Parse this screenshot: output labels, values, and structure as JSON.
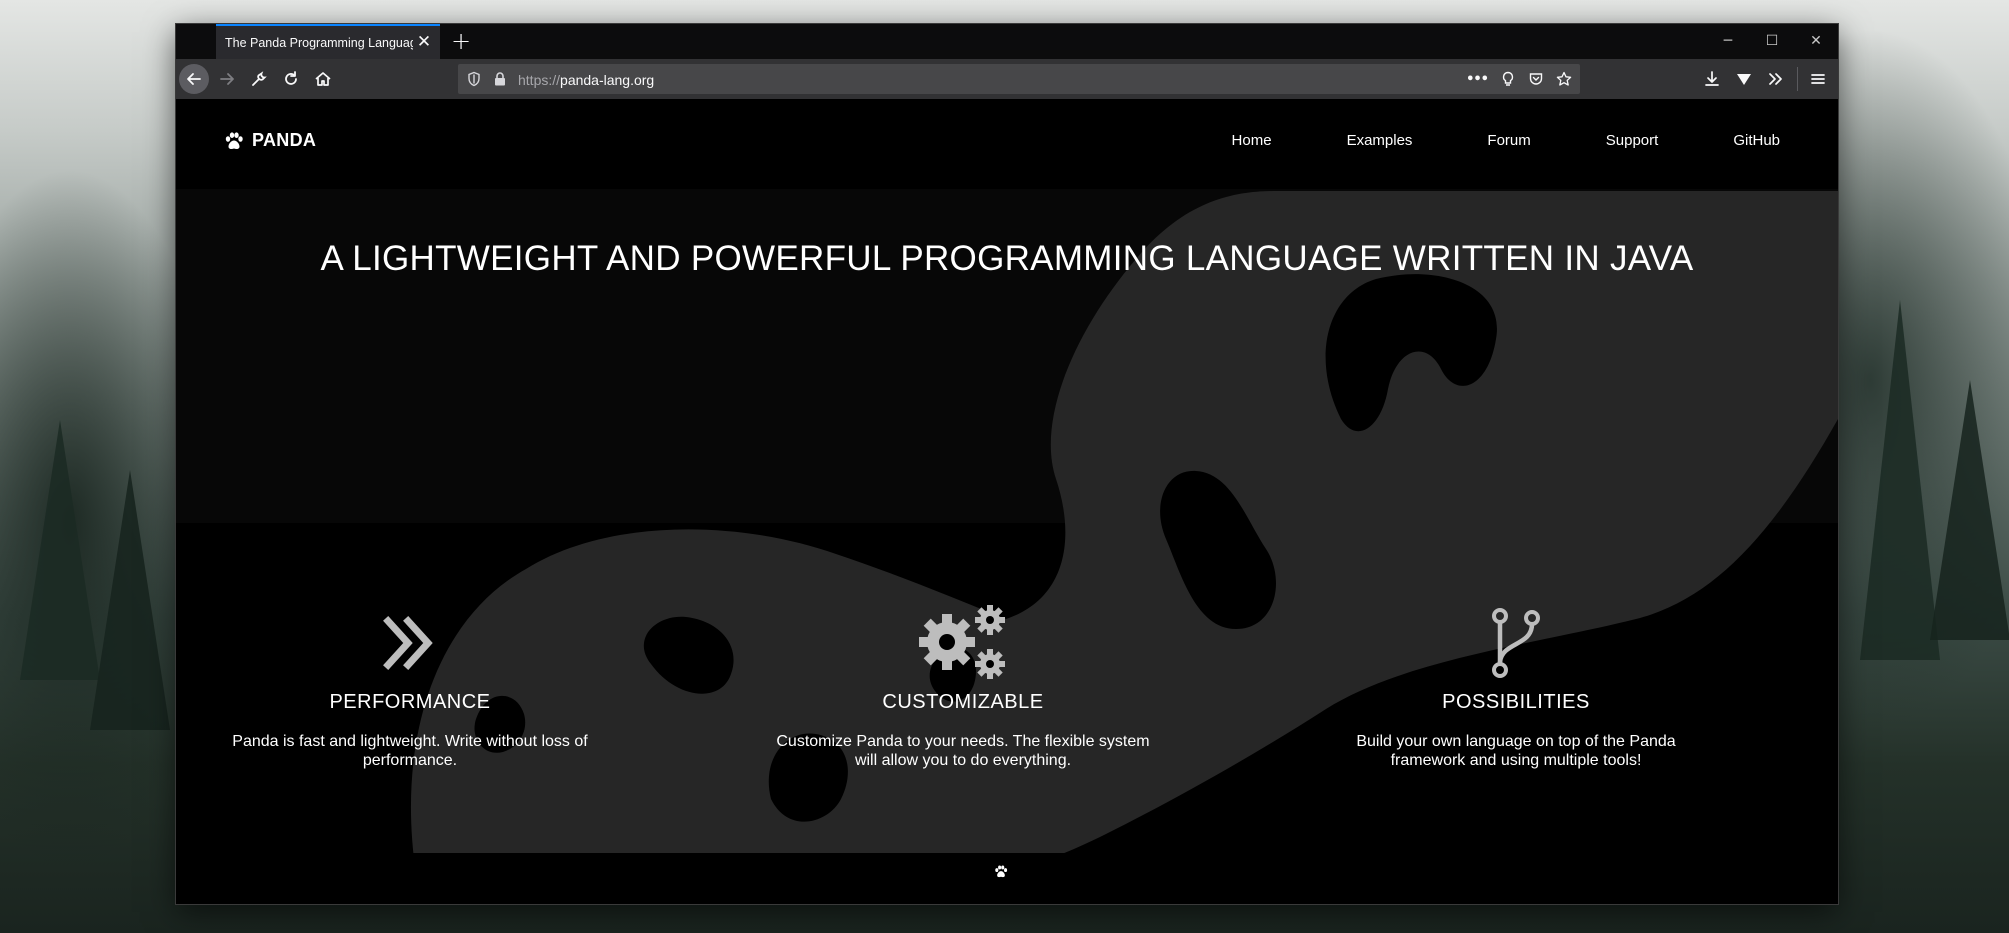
{
  "browser": {
    "tab_title": "The Panda Programming Language",
    "tab_close": "✕",
    "new_tab": "+",
    "url_scheme": "https://",
    "url_host": "panda-lang.org",
    "page_actions_label": "•••",
    "minimize": "─",
    "maximize": "☐",
    "close": "✕"
  },
  "site": {
    "logo_text": "PANDA",
    "nav": [
      "Home",
      "Examples",
      "Forum",
      "Support",
      "GitHub"
    ],
    "hero_title": "A LIGHTWEIGHT AND POWERFUL PROGRAMMING LANGUAGE WRITTEN IN JAVA",
    "features": [
      {
        "icon": "double-chevron-right-icon",
        "title": "PERFORMANCE",
        "text": "Panda is fast and lightweight. Write without loss of performance."
      },
      {
        "icon": "gears-icon",
        "title": "CUSTOMIZABLE",
        "text": "Customize Panda to your needs. The flexible system will allow you to do everything."
      },
      {
        "icon": "branch-icon",
        "title": "POSSIBILITIES",
        "text": "Build your own language on top of the Panda framework and using multiple tools!"
      }
    ]
  },
  "colors": {
    "accent": "#0a84ff",
    "page_bg": "#000000",
    "ghost_shape": "#262626",
    "icon_gray": "#bdbdbd"
  }
}
